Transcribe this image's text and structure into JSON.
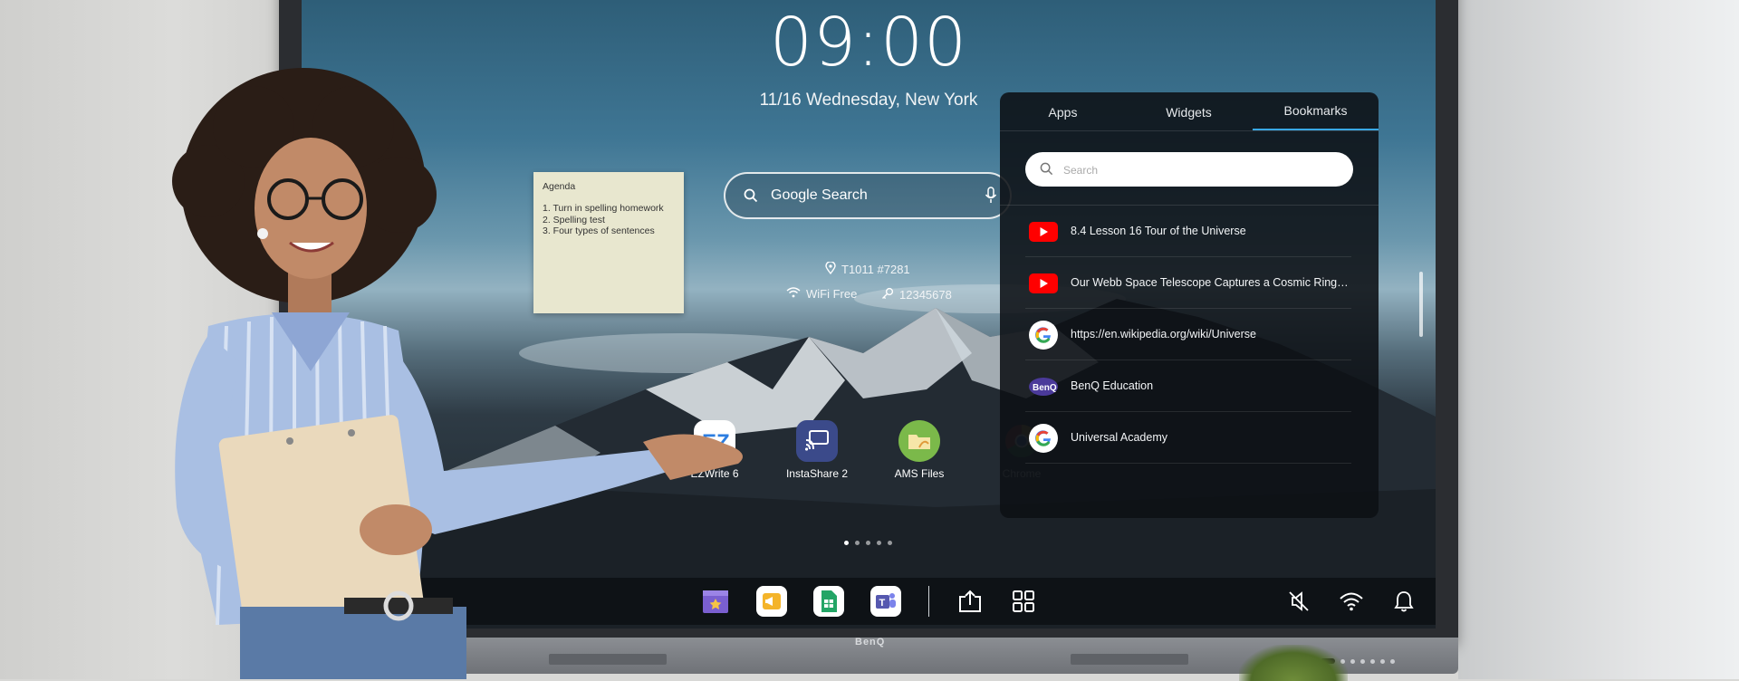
{
  "clock": {
    "time": "09:00",
    "date": "11/16 Wednesday, New York"
  },
  "note": {
    "title": "Agenda",
    "items": [
      "1. Turn in spelling homework",
      "2. Spelling test",
      "3. Four types of sentences"
    ]
  },
  "google_search": {
    "label": "Google Search"
  },
  "room_info": {
    "room": "T1011 #7281",
    "wifi": "WiFi Free",
    "password": "12345678"
  },
  "apps": [
    {
      "label": "EZWrite 6",
      "icon": "ezwrite-icon"
    },
    {
      "label": "InstaShare 2",
      "icon": "instashare-icon"
    },
    {
      "label": "AMS Files",
      "icon": "ams-files-icon"
    },
    {
      "label": "Chrome",
      "icon": "chrome-icon"
    }
  ],
  "page_dots": {
    "count": 5,
    "active": 1
  },
  "panel": {
    "tabs": [
      "Apps",
      "Widgets",
      "Bookmarks"
    ],
    "active_tab": "Bookmarks",
    "search_placeholder": "Search",
    "bookmarks": [
      {
        "title": "8.4 Lesson 16 Tour of the Universe",
        "icon": "youtube-icon"
      },
      {
        "title": "Our Webb Space Telescope Captures a Cosmic Ring on…",
        "icon": "youtube-icon"
      },
      {
        "title": "https://en.wikipedia.org/wiki/Universe",
        "icon": "google-icon"
      },
      {
        "title": "BenQ Education",
        "icon": "benq-icon"
      },
      {
        "title": "Universal Academy",
        "icon": "google-icon"
      }
    ]
  },
  "taskbar": {
    "left": [
      "store-icon",
      "announcement-icon",
      "sheets-icon",
      "teams-icon"
    ],
    "middle": [
      "share-upload-icon",
      "apps-grid-icon"
    ],
    "right": [
      "mute-icon",
      "wifi-icon",
      "bell-icon"
    ]
  },
  "brand": "BenQ",
  "colors": {
    "accent": "#39a8e5",
    "youtube": "#ff0000",
    "panel_bg": "#0c1014"
  }
}
